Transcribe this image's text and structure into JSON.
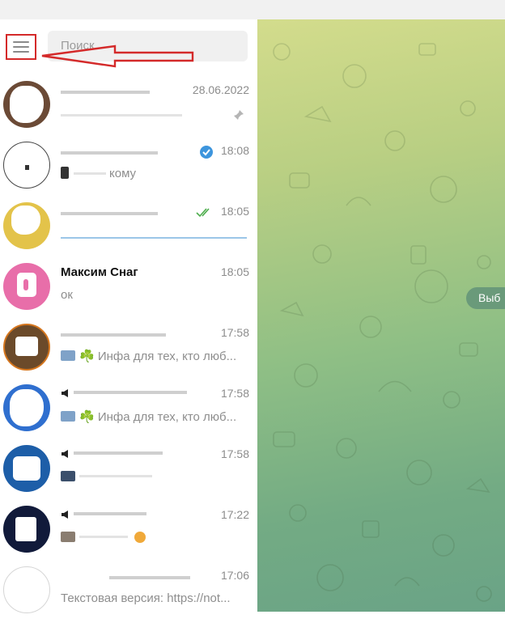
{
  "search": {
    "placeholder": "Поиск"
  },
  "chat_area": {
    "select_hint": "Выб"
  },
  "chats": [
    {
      "time": "28.06.2022",
      "preview": "",
      "pinned": true
    },
    {
      "time": "18:08",
      "preview": "кому",
      "verified": true
    },
    {
      "time": "18:05",
      "preview": "",
      "read": true
    },
    {
      "title": "Максим Снаг",
      "time": "18:05",
      "preview": "ок"
    },
    {
      "time": "17:58",
      "preview": "☘️ Инфа для тех, кто люб..."
    },
    {
      "time": "17:58",
      "preview": "☘️ Инфа для тех, кто люб..."
    },
    {
      "time": "17:58",
      "preview": ""
    },
    {
      "time": "17:22",
      "preview": ""
    },
    {
      "time": "17:06",
      "preview": "Текстовая версия: https://not..."
    }
  ],
  "colors": {
    "accent": "#3d95dd",
    "annotation": "#d42a2a",
    "read_check": "#4fae4e"
  }
}
